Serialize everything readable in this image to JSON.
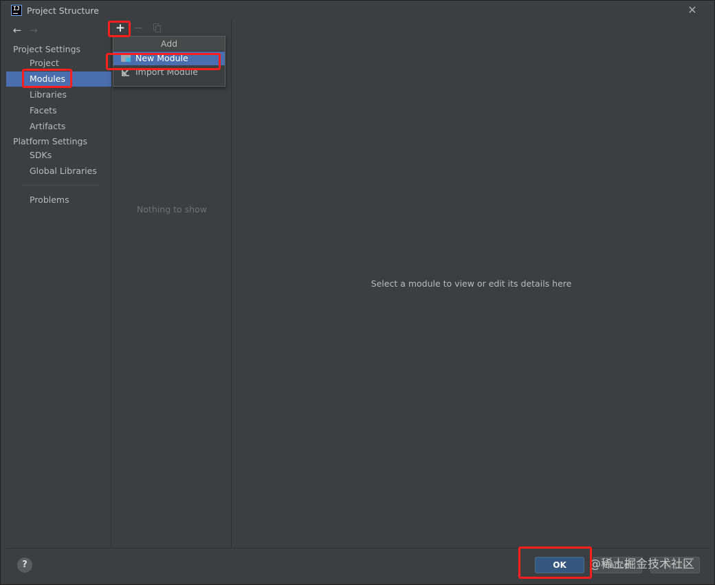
{
  "window": {
    "title": "Project Structure",
    "app_icon_text": "IJ"
  },
  "nav": {
    "back_icon": "arrow-left-icon",
    "forward_icon": "arrow-right-icon"
  },
  "sidebar": {
    "project_settings_title": "Project Settings",
    "project_items": [
      {
        "label": "Project"
      },
      {
        "label": "Modules",
        "selected": true
      },
      {
        "label": "Libraries"
      },
      {
        "label": "Facets"
      },
      {
        "label": "Artifacts"
      }
    ],
    "platform_settings_title": "Platform Settings",
    "platform_items": [
      {
        "label": "SDKs"
      },
      {
        "label": "Global Libraries"
      }
    ],
    "problems_label": "Problems"
  },
  "list_panel": {
    "toolbar": {
      "add_icon": "plus-icon",
      "remove_icon": "minus-icon",
      "copy_icon": "copy-icon"
    },
    "empty_text": "Nothing to show"
  },
  "add_popup": {
    "header": "Add",
    "items": [
      {
        "label": "New Module",
        "icon": "folder-module-icon",
        "selected": true
      },
      {
        "label": "Import Module",
        "icon": "import-arrow-icon"
      }
    ]
  },
  "detail": {
    "placeholder": "Select a module to view or edit its details here"
  },
  "footer": {
    "help_label": "?",
    "ok_label": "OK",
    "cancel_label": "Cancel",
    "apply_label": "Apply"
  },
  "watermark": "@稀土掘金技术社区",
  "colors": {
    "selection": "#4b6eaf",
    "highlight": "#ff1e1e",
    "primary_button": "#365880"
  }
}
